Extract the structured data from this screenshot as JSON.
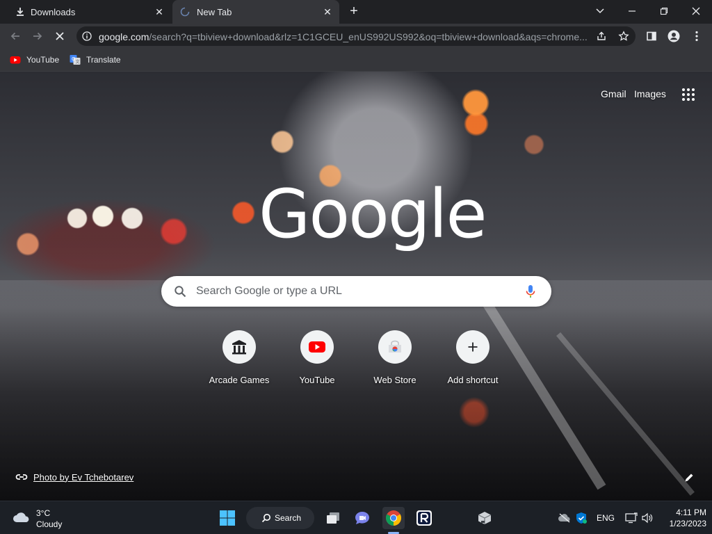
{
  "tabs": [
    {
      "title": "Downloads",
      "icon": "download-icon"
    },
    {
      "title": "New Tab",
      "icon": "loading-spinner-icon"
    }
  ],
  "omnibox": {
    "host": "google.com",
    "path": "/search?q=tbiview+download&rlz=1C1GCEU_enUS992US992&oq=tbiview+download&aqs=chrome..."
  },
  "bookmarks": [
    {
      "label": "YouTube",
      "icon": "youtube-icon"
    },
    {
      "label": "Translate",
      "icon": "translate-icon"
    }
  ],
  "ntp": {
    "gmail_label": "Gmail",
    "images_label": "Images",
    "logo_text": "Google",
    "search_placeholder": "Search Google or type a URL",
    "shortcuts": [
      {
        "label": "Arcade Games",
        "icon": "arcade-games-icon"
      },
      {
        "label": "YouTube",
        "icon": "youtube-icon"
      },
      {
        "label": "Web Store",
        "icon": "web-store-icon"
      },
      {
        "label": "Add shortcut",
        "icon": "plus-icon"
      }
    ],
    "attribution": "Photo by Ev Tchebotarev"
  },
  "taskbar": {
    "weather_temp": "3°C",
    "weather_condition": "Cloudy",
    "search_label": "Search",
    "language": "ENG",
    "time": "4:11 PM",
    "date": "1/23/2023"
  },
  "colors": {
    "tab_strip": "#202124",
    "toolbar": "#35363a",
    "accent_blue": "#8ab4f8",
    "youtube_red": "#ff0000",
    "taskbar": "#1c2026"
  }
}
